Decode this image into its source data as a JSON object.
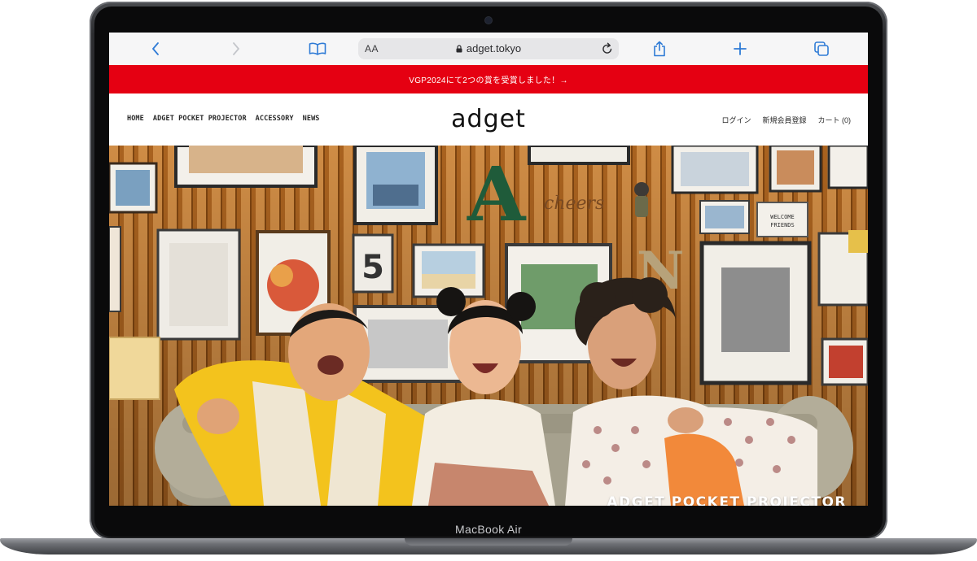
{
  "browser": {
    "address_prefix": "AA",
    "url": "adget.tokyo"
  },
  "announcement": {
    "text": "VGP2024にて2つの賞を受賞しました！→"
  },
  "site": {
    "logo": "adget",
    "nav_left": [
      "HOME",
      "ADGET POCKET PROJECTOR",
      "ACCESSORY",
      "NEWS"
    ],
    "nav_right": [
      "ログイン",
      "新規会員登録",
      "カート (0)"
    ]
  },
  "hero": {
    "caption": "ADGET POCKET PROJECTOR",
    "photo_text": {
      "letter_a": "A",
      "letter_n": "N",
      "number": "5",
      "script": "cheers",
      "sign_line1": "WELCOME",
      "sign_line2": "FRIENDS"
    }
  },
  "device": {
    "label": "MacBook Air"
  },
  "colors": {
    "accent_red": "#e50012",
    "safari_blue": "#2f7bd6",
    "wall": "#b8702c"
  },
  "icons": {
    "back": "chevron-left-icon",
    "forward": "chevron-right-icon",
    "bookmarks": "book-icon",
    "share": "share-icon",
    "new_tab": "plus-icon",
    "tabs": "tabs-icon",
    "lock": "lock-icon",
    "reload": "reload-icon"
  }
}
